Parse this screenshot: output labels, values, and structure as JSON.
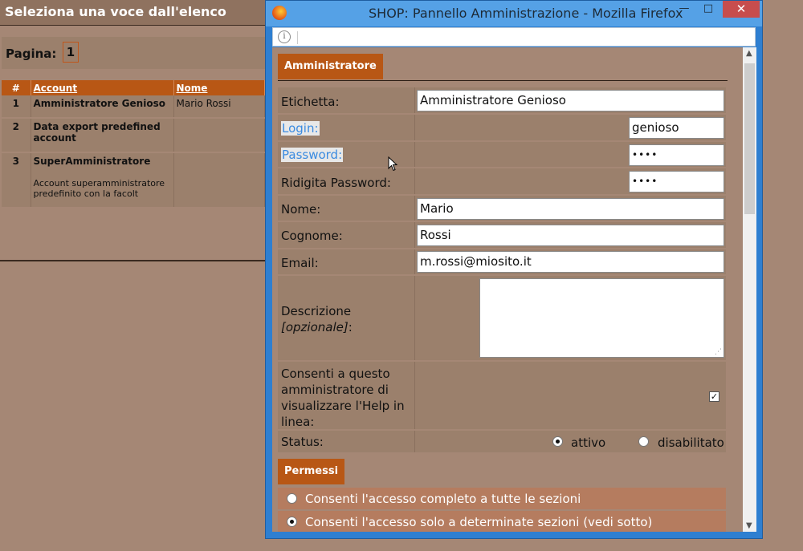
{
  "background": {
    "header_title": "Seleziona una voce dall'elenco",
    "pagination_label": "Pagina:",
    "current_page": "1",
    "table": {
      "columns": [
        "#",
        "Account",
        "Nome"
      ],
      "rows": [
        {
          "index": "1",
          "account": "Amministratore Genioso",
          "description": "",
          "name": "Mario Rossi"
        },
        {
          "index": "2",
          "account": "Data export predefined account",
          "description": "",
          "name": ""
        },
        {
          "index": "3",
          "account": "SuperAmministratore",
          "description": "Account superamministratore predefinito con la facolt",
          "name": ""
        }
      ]
    }
  },
  "browser": {
    "title": "SHOP: Pannello Amministrazione - Mozilla Firefox",
    "minimize": "—",
    "maximize": "□",
    "close": "✕",
    "info_icon": "i"
  },
  "form": {
    "section_title": "Amministratore",
    "fields": {
      "etichetta": {
        "label": "Etichetta:",
        "value": "Amministratore Genioso"
      },
      "login": {
        "label": "Login:",
        "value": "genioso"
      },
      "password": {
        "label": "Password:",
        "value": "••••"
      },
      "ridigita": {
        "label": "Ridigita Password:",
        "value": "••••"
      },
      "nome": {
        "label": "Nome:",
        "value": "Mario"
      },
      "cognome": {
        "label": "Cognome:",
        "value": "Rossi"
      },
      "email": {
        "label": "Email:",
        "value": "m.rossi@miosito.it"
      },
      "descrizione": {
        "label": "Descrizione",
        "optional": "[opzionale]",
        "suffix": ":",
        "value": ""
      },
      "help": {
        "label": "Consenti a questo amministratore di visualizzare l'Help in linea:",
        "checked": true,
        "check_mark": "✓"
      },
      "status": {
        "label": "Status:",
        "options": [
          "attivo",
          "disabilitato"
        ],
        "selected": "attivo"
      }
    },
    "permissions": {
      "section_title": "Permessi",
      "options": [
        {
          "label": "Consenti l'accesso completo a tutte le sezioni",
          "selected": false
        },
        {
          "label": "Consenti l'accesso solo a determinate sezioni (vedi sotto)",
          "selected": true
        }
      ]
    }
  },
  "colors": {
    "accent": "#b85715",
    "page_bg": "#a58775",
    "row_bg": "#9b806c",
    "titlebar": "#55a1e6",
    "close_button": "#c74d4d",
    "link_label": "#3b8be0"
  }
}
